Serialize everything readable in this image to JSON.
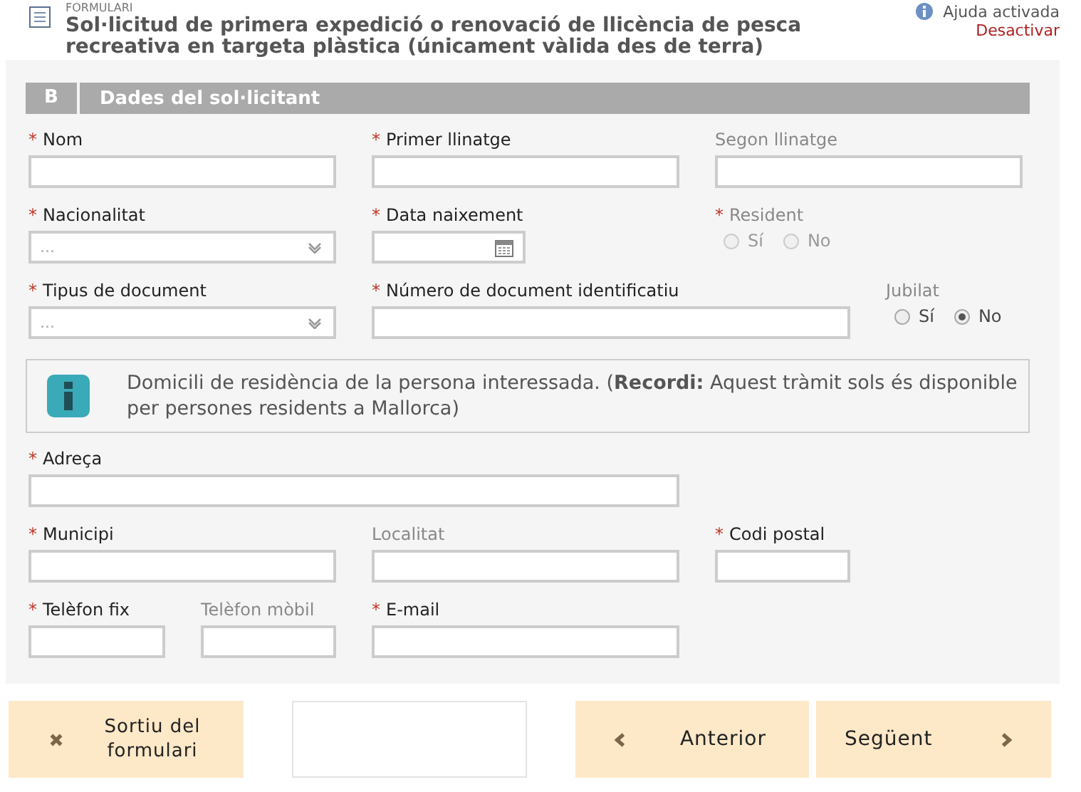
{
  "header": {
    "category": "FORMULARI",
    "title": "Sol·licitud de primera expedició o renovació de llicència de pesca recreativa en targeta plàstica (únicament vàlida des de terra)",
    "help_status": "Ajuda activada",
    "help_action": "Desactivar"
  },
  "section": {
    "letter": "B",
    "title": "Dades del sol·licitant"
  },
  "rows_top": [
    [
      {
        "kind": "text",
        "label": "Nom",
        "required": true,
        "mark": "*"
      },
      {
        "kind": "text",
        "label": "Primer llinatge",
        "required": true,
        "mark": "*"
      },
      {
        "kind": "text",
        "label": "Segon llinatge",
        "required": false
      }
    ],
    [
      {
        "kind": "select",
        "label": "Nacionalitat",
        "required": true,
        "mark": "*",
        "value": "..."
      },
      {
        "kind": "date",
        "label": "Data naixement",
        "required": true,
        "mark": "*"
      },
      {
        "kind": "radio",
        "label": "Resident",
        "required": true,
        "mark": "*",
        "disabled": true,
        "options": [
          {
            "label": "Sí",
            "selected": false
          },
          {
            "label": "No",
            "selected": false
          }
        ]
      }
    ],
    [
      {
        "kind": "select",
        "label": "Tipus de document",
        "required": true,
        "mark": "*",
        "value": "..."
      },
      {
        "kind": "text",
        "label": "Número de document identificatiu",
        "required": true,
        "mark": "*"
      },
      {
        "kind": "radio",
        "label": "Jubilat",
        "required": false,
        "disabled": false,
        "options": [
          {
            "label": "Sí",
            "selected": false
          },
          {
            "label": "No",
            "selected": true
          }
        ]
      }
    ]
  ],
  "notice": "Domicili de residència de la persona interessada. (**Recordi:** Aquest tràmit sols és disponible per persones residents a Mallorca)",
  "rows_bottom": [
    [
      {
        "kind": "text",
        "label": "Adreça",
        "required": true,
        "mark": "*"
      }
    ],
    [
      {
        "kind": "text",
        "label": "Municipi",
        "required": true,
        "mark": "*"
      },
      {
        "kind": "text",
        "label": "Localitat",
        "required": false
      },
      {
        "kind": "text",
        "label": "Codi postal",
        "required": true,
        "mark": "*"
      }
    ],
    [
      {
        "kind": "text",
        "label": "Telèfon fix",
        "required": true,
        "mark": "*"
      },
      {
        "kind": "text",
        "label": "Telèfon mòbil",
        "required": false
      },
      {
        "kind": "text",
        "label": "E-mail",
        "required": true,
        "mark": "*"
      }
    ]
  ],
  "buttons": [
    {
      "kind": "exit",
      "label": "Sortiu del formulari"
    },
    {
      "kind": "blank"
    },
    {
      "kind": "prev",
      "label": "Anterior"
    },
    {
      "kind": "next",
      "label": "Següent"
    }
  ]
}
